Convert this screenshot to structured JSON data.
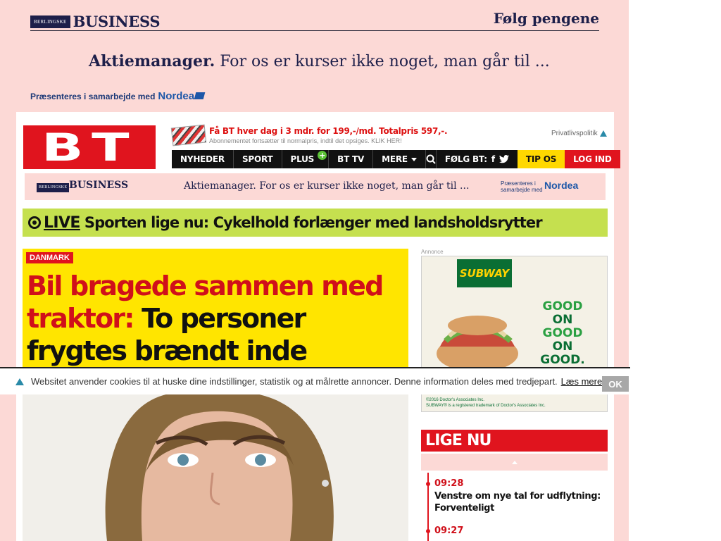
{
  "top_ad": {
    "brand_chip": "BERLINGSKE",
    "brand_word": "BUSINESS",
    "tagline": "Følg pengene",
    "headline_bold": "Aktiemanager.",
    "headline_rest": " For os er kurser ikke noget, man går til ...",
    "presented_by": "Præsenteres i samarbejde med",
    "sponsor": "Nordea"
  },
  "header": {
    "logo": "BT",
    "promo_title": "Få BT hver dag i 3 mdr. for 199,-/md. Totalpris 597,-.",
    "promo_sub": "Abonnementet fortsætter til normalpris, indtil det opsiges. KLIK HER!",
    "privacy": "Privatlivspolitik"
  },
  "nav": {
    "items": [
      "NYHEDER",
      "SPORT",
      "PLUS",
      "BT TV",
      "MERE"
    ],
    "plus_badge": "+",
    "follow": "FØLG BT:",
    "facebook": "f",
    "tip": "TIP OS",
    "login": "LOG IND"
  },
  "inner_ad": {
    "brand_chip": "BERLINGSKE",
    "brand_word": "BUSINESS",
    "headline": "Aktiemanager. For os er kurser ikke noget, man går til ...",
    "presented_by": "Præsenteres i samarbejde med",
    "sponsor": "Nordea"
  },
  "live": {
    "label": "LIVE",
    "text": "Sporten lige nu: Cykelhold forlænger med landsholdsrytter"
  },
  "article": {
    "tag": "DANMARK",
    "headline_red": "Bil bragede sammen med traktor:",
    "headline_black": " To personer frygtes brændt inde"
  },
  "side_ad": {
    "label": "Annonce",
    "logo": "SUBWAY",
    "lines": [
      "GOOD",
      "ON",
      "GOOD",
      "ON",
      "GOOD."
    ],
    "fine1": "©2016 Doctor's Associates Inc.",
    "fine2": "SUBWAY® is a registered trademark of Doctor's Associates Inc."
  },
  "lige_nu": {
    "title": "LIGE NU",
    "items": [
      {
        "time": "09:28",
        "title": "Venstre om nye tal for udflytning: Forventeligt"
      },
      {
        "time": "09:27",
        "title": ""
      }
    ]
  },
  "cookie": {
    "text": "Websitet anvender cookies til at huske dine indstillinger, statistik og at målrette annoncer. Denne information deles med tredjepart.",
    "link": "Læs mere",
    "ok": "OK"
  }
}
